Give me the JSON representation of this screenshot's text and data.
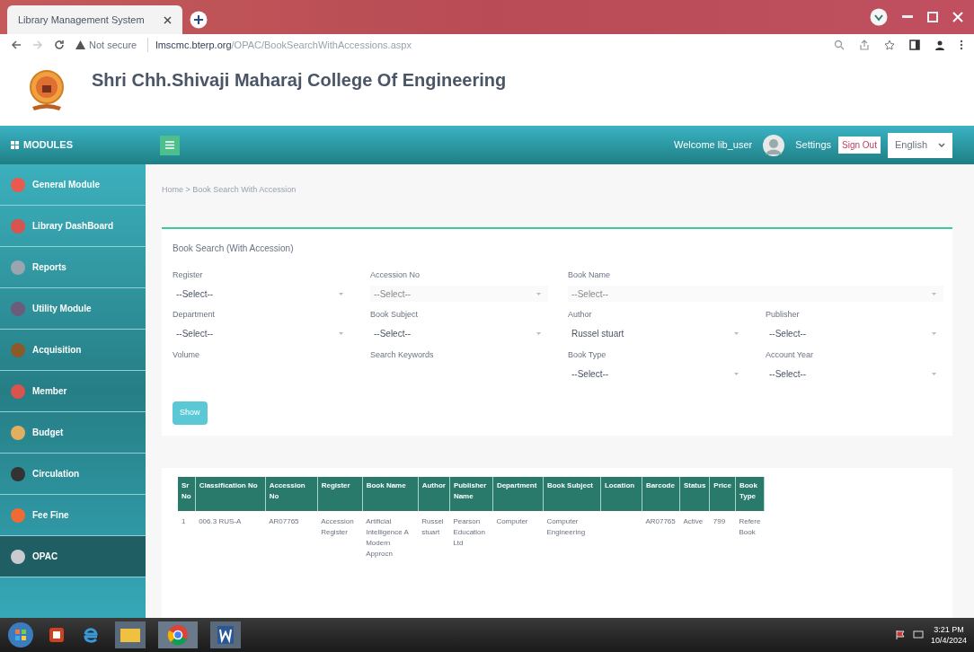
{
  "browser": {
    "tab_title": "Library Management System",
    "not_secure": "Not secure",
    "url_host": "lmscmc.bterp.org",
    "url_path": "/OPAC/BookSearchWithAccessions.aspx"
  },
  "header": {
    "college_name": "Shri Chh.Shivaji Maharaj College Of Engineering"
  },
  "topbar": {
    "modules_label": "MODULES",
    "welcome": "Welcome lib_user",
    "settings": "Settings",
    "sign_out": "Sign Out",
    "language": "English"
  },
  "sidebar": {
    "items": [
      {
        "label": "General Module",
        "color": "#e85a4f",
        "selected": false
      },
      {
        "label": "Library DashBoard",
        "color": "#d9534f",
        "selected": false
      },
      {
        "label": "Reports",
        "color": "#9aa5b1",
        "selected": false
      },
      {
        "label": "Utility Module",
        "color": "#6c5b7b",
        "selected": false
      },
      {
        "label": "Acquisition",
        "color": "#8b5a2b",
        "selected": false
      },
      {
        "label": "Member",
        "color": "#d9534f",
        "selected": false
      },
      {
        "label": "Budget",
        "color": "#e0b060",
        "selected": false
      },
      {
        "label": "Circulation",
        "color": "#333333",
        "selected": false
      },
      {
        "label": "Fee Fine",
        "color": "#f06a35",
        "selected": false
      },
      {
        "label": "OPAC",
        "color": "#c8ccd0",
        "selected": true
      }
    ]
  },
  "breadcrumb": "Home > Book Search With Accession",
  "form": {
    "title": "Book Search (With Accession)",
    "fields": [
      {
        "kind": "select",
        "label": "Register",
        "value": "--Select--",
        "disabled": false,
        "wide": false
      },
      {
        "kind": "select",
        "label": "Accession No",
        "value": "--Select--",
        "disabled": true,
        "wide": false
      },
      {
        "kind": "select",
        "label": "Book Name",
        "value": "--Select--",
        "disabled": true,
        "wide": true
      },
      {
        "kind": "select",
        "label": "Department",
        "value": "--Select--",
        "disabled": false,
        "wide": false
      },
      {
        "kind": "select",
        "label": "Book Subject",
        "value": "--Select--",
        "disabled": false,
        "wide": false
      },
      {
        "kind": "select",
        "label": "Author",
        "value": "Russel stuart",
        "disabled": false,
        "wide": false
      },
      {
        "kind": "select",
        "label": "Publisher",
        "value": "--Select--",
        "disabled": false,
        "wide": false
      },
      {
        "kind": "text",
        "label": "Volume",
        "wide": false
      },
      {
        "kind": "text",
        "label": "Search Keywords",
        "wide": false
      },
      {
        "kind": "select",
        "label": "Book Type",
        "value": "--Select--",
        "disabled": false,
        "wide": false
      },
      {
        "kind": "select",
        "label": "Account Year",
        "value": "--Select--",
        "disabled": false,
        "wide": false
      }
    ],
    "button": "Show"
  },
  "table": {
    "columns": [
      "Sr No",
      "Classification No",
      "Accession No",
      "Register",
      "Book Name",
      "Author",
      "Publisher Name",
      "Department",
      "Book Subject",
      "Location",
      "Barcode",
      "Status",
      "Price",
      "Book Type"
    ],
    "rows": [
      [
        "1",
        "006.3 RUS-A",
        "AR07765",
        "Accession Register",
        "Artificial Intelligence A Modern Approcn",
        "Russel stuart",
        "Pearson Education Ltd",
        "Computer",
        "Computer Engineering",
        "",
        "AR07765",
        "Active",
        "799",
        "Refere Book"
      ]
    ]
  },
  "taskbar": {
    "time": "3:21 PM",
    "date": "10/4/2024"
  }
}
